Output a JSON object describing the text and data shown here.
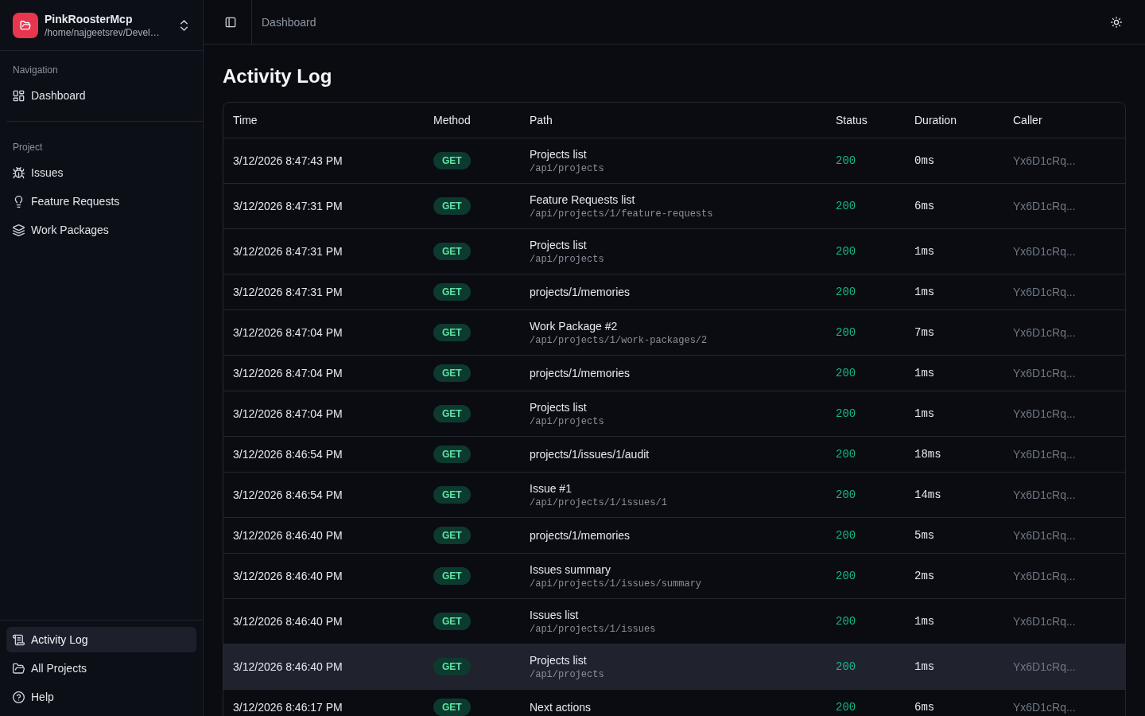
{
  "sidebar": {
    "project": {
      "name": "PinkRoosterMcp",
      "path": "/home/najgeetsrev/Devel…"
    },
    "sections": [
      {
        "label": "Navigation",
        "items": [
          {
            "label": "Dashboard",
            "selected": false
          }
        ]
      },
      {
        "label": "Project",
        "items": [
          {
            "label": "Issues",
            "selected": false
          },
          {
            "label": "Feature Requests",
            "selected": false
          },
          {
            "label": "Work Packages",
            "selected": false
          }
        ]
      }
    ],
    "footer": [
      {
        "label": "Activity Log",
        "selected": true
      },
      {
        "label": "All Projects",
        "selected": false
      },
      {
        "label": "Help",
        "selected": false
      }
    ]
  },
  "header": {
    "breadcrumb": "Dashboard"
  },
  "page": {
    "title": "Activity Log"
  },
  "table": {
    "columns": [
      "Time",
      "Method",
      "Path",
      "Status",
      "Duration",
      "Caller"
    ],
    "rows": [
      {
        "time": "3/12/2026 8:47:43 PM",
        "method": "GET",
        "title": "Projects list",
        "path": "/api/projects",
        "status": "200",
        "duration": "0ms",
        "caller": "Yx6D1cRq...",
        "hovered": false
      },
      {
        "time": "3/12/2026 8:47:31 PM",
        "method": "GET",
        "title": "Feature Requests list",
        "path": "/api/projects/1/feature-requests",
        "status": "200",
        "duration": "6ms",
        "caller": "Yx6D1cRq...",
        "hovered": false
      },
      {
        "time": "3/12/2026 8:47:31 PM",
        "method": "GET",
        "title": "Projects list",
        "path": "/api/projects",
        "status": "200",
        "duration": "1ms",
        "caller": "Yx6D1cRq...",
        "hovered": false
      },
      {
        "time": "3/12/2026 8:47:31 PM",
        "method": "GET",
        "title": "projects/1/memories",
        "status": "200",
        "duration": "1ms",
        "caller": "Yx6D1cRq...",
        "hovered": false
      },
      {
        "time": "3/12/2026 8:47:04 PM",
        "method": "GET",
        "title": "Work Package #2",
        "path": "/api/projects/1/work-packages/2",
        "status": "200",
        "duration": "7ms",
        "caller": "Yx6D1cRq...",
        "hovered": false
      },
      {
        "time": "3/12/2026 8:47:04 PM",
        "method": "GET",
        "title": "projects/1/memories",
        "status": "200",
        "duration": "1ms",
        "caller": "Yx6D1cRq...",
        "hovered": false
      },
      {
        "time": "3/12/2026 8:47:04 PM",
        "method": "GET",
        "title": "Projects list",
        "path": "/api/projects",
        "status": "200",
        "duration": "1ms",
        "caller": "Yx6D1cRq...",
        "hovered": false
      },
      {
        "time": "3/12/2026 8:46:54 PM",
        "method": "GET",
        "title": "projects/1/issues/1/audit",
        "status": "200",
        "duration": "18ms",
        "caller": "Yx6D1cRq...",
        "hovered": false
      },
      {
        "time": "3/12/2026 8:46:54 PM",
        "method": "GET",
        "title": "Issue #1",
        "path": "/api/projects/1/issues/1",
        "status": "200",
        "duration": "14ms",
        "caller": "Yx6D1cRq...",
        "hovered": false
      },
      {
        "time": "3/12/2026 8:46:40 PM",
        "method": "GET",
        "title": "projects/1/memories",
        "status": "200",
        "duration": "5ms",
        "caller": "Yx6D1cRq...",
        "hovered": false
      },
      {
        "time": "3/12/2026 8:46:40 PM",
        "method": "GET",
        "title": "Issues summary",
        "path": "/api/projects/1/issues/summary",
        "status": "200",
        "duration": "2ms",
        "caller": "Yx6D1cRq...",
        "hovered": false
      },
      {
        "time": "3/12/2026 8:46:40 PM",
        "method": "GET",
        "title": "Issues list",
        "path": "/api/projects/1/issues",
        "status": "200",
        "duration": "1ms",
        "caller": "Yx6D1cRq...",
        "hovered": false
      },
      {
        "time": "3/12/2026 8:46:40 PM",
        "method": "GET",
        "title": "Projects list",
        "path": "/api/projects",
        "status": "200",
        "duration": "1ms",
        "caller": "Yx6D1cRq...",
        "hovered": true
      },
      {
        "time": "3/12/2026 8:46:17 PM",
        "method": "GET",
        "title": "Next actions",
        "status": "200",
        "duration": "6ms",
        "caller": "Yx6D1cRq...",
        "hovered": false
      }
    ]
  }
}
